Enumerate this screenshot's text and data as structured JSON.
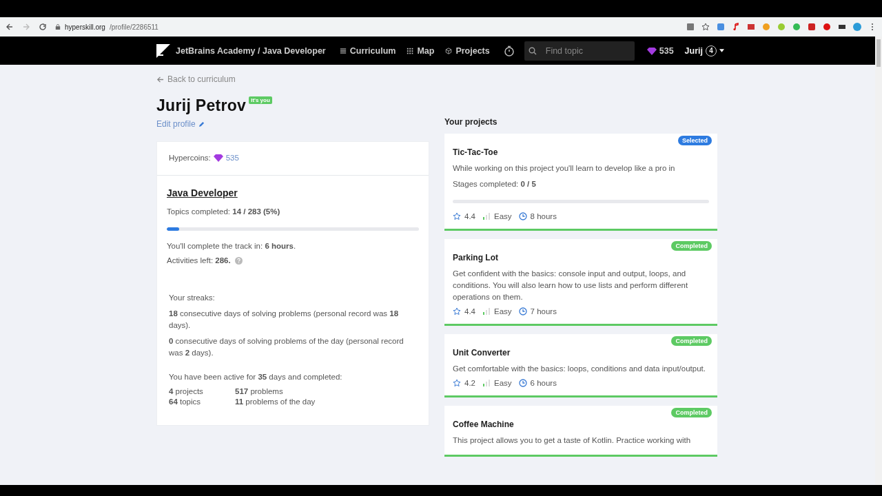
{
  "browser": {
    "url_host": "hyperskill.org",
    "url_path": "/profile/2286511"
  },
  "nav": {
    "brand": "JetBrains Academy / Java Developer",
    "links": [
      {
        "label": "Curriculum",
        "kind": "list"
      },
      {
        "label": "Map",
        "kind": "grid"
      },
      {
        "label": "Projects",
        "kind": "cube"
      }
    ],
    "search": {
      "placeholder": "Find topic"
    },
    "gems": "535",
    "user": "Jurij",
    "level": "4"
  },
  "back_link": "Back to curriculum",
  "profile": {
    "name": "Jurij Petrov",
    "badge": "It's you",
    "edit": "Edit profile"
  },
  "stats": {
    "hypercoins_label": "Hypercoins:",
    "hypercoins": "535",
    "track": {
      "title": "Java Developer",
      "topics": "Topics completed: **14 / 283 (5%)**",
      "level": 0.05,
      "complete": "You'll complete the track in: **6 hours**.",
      "activities": "Activities left: **286.**"
    },
    "streaks_title": "Your streaks:",
    "streaks": [
      "**18** consecutive days of solving problems (personal record was **18** days).",
      "**0** consecutive days of solving problems of the day (personal record was **2** days)."
    ],
    "active": "You have been active for **35** days and completed:",
    "totals": [
      "**4** projects",
      "**517** problems",
      "**64** topics",
      "**11** problems of the day"
    ]
  },
  "projects_title": "Your projects",
  "projects": [
    {
      "kind": "selected",
      "badge": "Selected",
      "title": "Tic-Tac-Toe",
      "description": "While working on this project you'll learn to develop like a pro in",
      "stages": "Stages completed: **0 / 5**",
      "level": 0,
      "rating": "4.4",
      "difficulty": "Easy",
      "time": "8 hours"
    },
    {
      "kind": "completed",
      "badge": "Completed",
      "title": "Parking Lot",
      "description": "Get confident with the basics: console input and output, loops, and conditions. You will also learn how to use lists and perform different operations on them.",
      "rating": "4.4",
      "difficulty": "Easy",
      "time": "7 hours"
    },
    {
      "kind": "completed",
      "badge": "Completed",
      "title": "Unit Converter",
      "description": "Get comfortable with the basics: loops, conditions and data input/output.",
      "rating": "4.2",
      "difficulty": "Easy",
      "time": "6 hours"
    },
    {
      "kind": "completed",
      "badge": "Completed",
      "title": "Coffee Machine",
      "description": "This project allows you to get a taste of Kotlin. Practice working with"
    }
  ]
}
